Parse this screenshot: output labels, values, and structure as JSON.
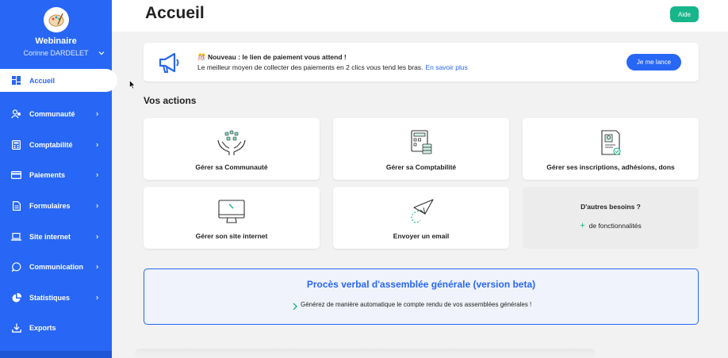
{
  "sidebar": {
    "org_name": "Webinaire",
    "org_user": "Corinne DARDELET",
    "items": [
      {
        "label": "Accueil",
        "icon": "dashboard-icon",
        "active": true
      },
      {
        "label": "Communauté",
        "icon": "community-icon",
        "arrow": "›"
      },
      {
        "label": "Comptabilité",
        "icon": "calculator-icon",
        "arrow": "›"
      },
      {
        "label": "Paiements",
        "icon": "credit-card-icon",
        "arrow": "›"
      },
      {
        "label": "Formulaires",
        "icon": "form-icon",
        "arrow": "›"
      },
      {
        "label": "Site internet",
        "icon": "laptop-icon",
        "arrow": "›"
      },
      {
        "label": "Communication",
        "icon": "chat-icon",
        "arrow": "›"
      },
      {
        "label": "Statistiques",
        "icon": "pie-chart-icon",
        "arrow": "›"
      },
      {
        "label": "Exports",
        "icon": "download-icon"
      }
    ]
  },
  "header": {
    "title": "Accueil",
    "help_label": "Aide"
  },
  "banner": {
    "title": "🎊 Nouveau : le lien de paiement vous attend !",
    "text": "Le meilleur moyen de collecter des paiements en 2 clics vous tend les bras.",
    "link": "En savoir plus",
    "button": "Je me lance"
  },
  "actions": {
    "title": "Vos actions",
    "cards": [
      {
        "label": "Gérer sa Communauté",
        "icon": "hands-community-icon"
      },
      {
        "label": "Gérer sa Comptabilité",
        "icon": "accounting-icon"
      },
      {
        "label": "Gérer ses inscriptions, adhésions, dons",
        "icon": "membership-certificate-icon"
      },
      {
        "label": "Gérer son site internet",
        "icon": "monitor-icon"
      },
      {
        "label": "Envoyer un email",
        "icon": "paper-plane-icon"
      }
    ],
    "other": {
      "title": "D'autres besoins ?",
      "link": "de fonctionnalités",
      "plus": "+"
    }
  },
  "pv": {
    "title": "Procès verbal d'assemblée générale (version beta)",
    "text": "Générez de manière automatique le compte rendu de vos assemblées générales !"
  },
  "colors": {
    "primary": "#2867f5",
    "accent": "#17b58a"
  }
}
